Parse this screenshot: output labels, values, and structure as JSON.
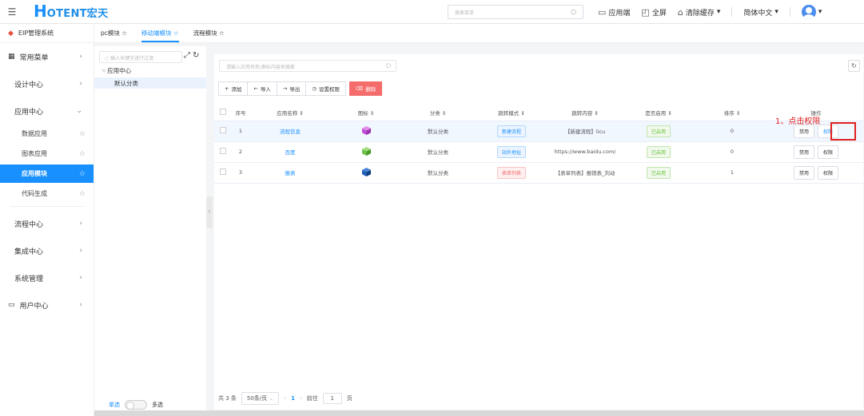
{
  "topbar": {
    "logo_h": "H",
    "logo_text": "OTENT宏天",
    "search_placeholder": "搜索菜单",
    "app_end": "应用端",
    "fullscreen": "全屏",
    "clear_cache": "清除缓存",
    "language": "简体中文"
  },
  "sidebar": {
    "system": "EIP管理系统",
    "common_menu": "常用菜单",
    "design_center": "设计中心",
    "app_center": "应用中心",
    "sub_items": [
      "数据应用",
      "图表应用",
      "应用模块",
      "代码生成"
    ],
    "flow_center": "流程中心",
    "integration_center": "集成中心",
    "system_admin": "系统管理",
    "user_center": "用户中心"
  },
  "tabs": [
    "pc模块",
    "移动端模块",
    "流程模块"
  ],
  "tree": {
    "search_placeholder": "输入关键字进行过滤",
    "root": "应用中心",
    "child": "默认分类",
    "single": "单选",
    "multi": "多选"
  },
  "main": {
    "search_placeholder": "请输入应用名称,图标内容来搜索",
    "buttons": {
      "add": "添加",
      "import": "导入",
      "export": "导出",
      "set_permission": "设置权限",
      "delete": "删除"
    },
    "columns": [
      "序号",
      "应用名称",
      "图标",
      "分类",
      "跳转模式",
      "跳转内容",
      "是否启用",
      "排序",
      "操作"
    ],
    "rows": [
      {
        "index": "1",
        "name": "流程信息",
        "icon_color": "#c24fd6",
        "category": "默认分类",
        "mode": "新建流程",
        "mode_style": "blue",
        "content": "【新建流程】licu",
        "enabled": "已启用",
        "sort": "0",
        "op_disable": "禁用",
        "op_perm": "权限"
      },
      {
        "index": "2",
        "name": "百度",
        "icon_color": "#6cc04a",
        "category": "默认分类",
        "mode": "站外地址",
        "mode_style": "blue",
        "content": "https://www.baidu.com/",
        "enabled": "已启用",
        "sort": "0",
        "op_disable": "禁用",
        "op_perm": "权限"
      },
      {
        "index": "3",
        "name": "报表",
        "icon_color": "#1f5fb8",
        "category": "默认分类",
        "mode": "表单列表",
        "mode_style": "red",
        "content": "【表单列表】报销表_刘动",
        "enabled": "已启用",
        "sort": "1",
        "op_disable": "禁用",
        "op_perm": "权限"
      }
    ],
    "annotation": "1、点击权限",
    "pager": {
      "total": "共 3 条",
      "page_size": "50条/页",
      "current": "1",
      "goto_label": "前往",
      "goto_value": "1",
      "page_suffix": "页"
    }
  }
}
